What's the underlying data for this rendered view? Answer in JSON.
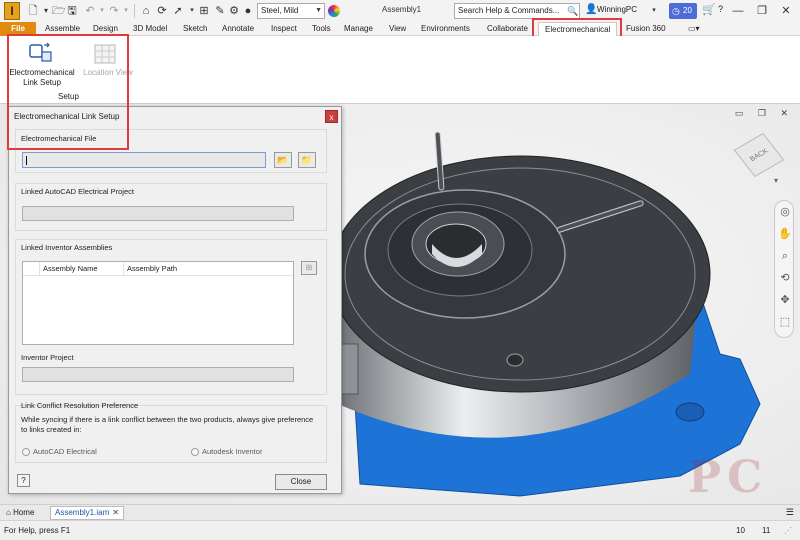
{
  "titlebar": {
    "app_logo": "I",
    "material": "Steel, Mild",
    "document_title": "Assembly1",
    "search_placeholder": "Search Help & Commands...",
    "user": "WinningPC",
    "trial_days": "20",
    "help_icon": "?"
  },
  "ribbon": {
    "tabs": [
      "File",
      "Assemble",
      "Design",
      "3D Model",
      "Sketch",
      "Annotate",
      "Inspect",
      "Tools",
      "Manage",
      "View",
      "Environments",
      "Collaborate",
      "Electromechanical",
      "Fusion 360"
    ],
    "active_tab": "Electromechanical",
    "buttons": {
      "link_setup_label": "Electromechanical\nLink Setup",
      "location_view_label": "Location View"
    },
    "panel_label": "Setup"
  },
  "dialog": {
    "title": "Electromechanical Link Setup",
    "close_x": "x",
    "electromechanical_file_label": "Electromechanical File",
    "linked_autocad_label": "Linked AutoCAD Electrical Project",
    "linked_inventor_label": "Linked Inventor Assemblies",
    "columns": [
      "Assembly Name",
      "Assembly Path"
    ],
    "inventor_project_label": "Inventor Project",
    "conflict_label": "Link Conflict Resolution Preference",
    "conflict_desc": "While syncing if there is a link conflict between the two products, always give preference to links created in:",
    "radio_autocad": "AutoCAD Electrical",
    "radio_inventor": "Autodesk Inventor",
    "help_button": "?",
    "close_button": "Close"
  },
  "doc_tabs": {
    "home": "Home",
    "active": "Assembly1.iam",
    "close_x": "✕"
  },
  "statusbar": {
    "help_text": "For Help, press F1",
    "value1": "10",
    "value2": "11"
  },
  "viewcube": {
    "label": "BACK"
  },
  "watermark": "PC",
  "colors": {
    "highlight": "#e0393e",
    "file_tab": "#e08b0f",
    "selection_blue": "#1e73d6",
    "part_gray": "#3b3e42"
  }
}
